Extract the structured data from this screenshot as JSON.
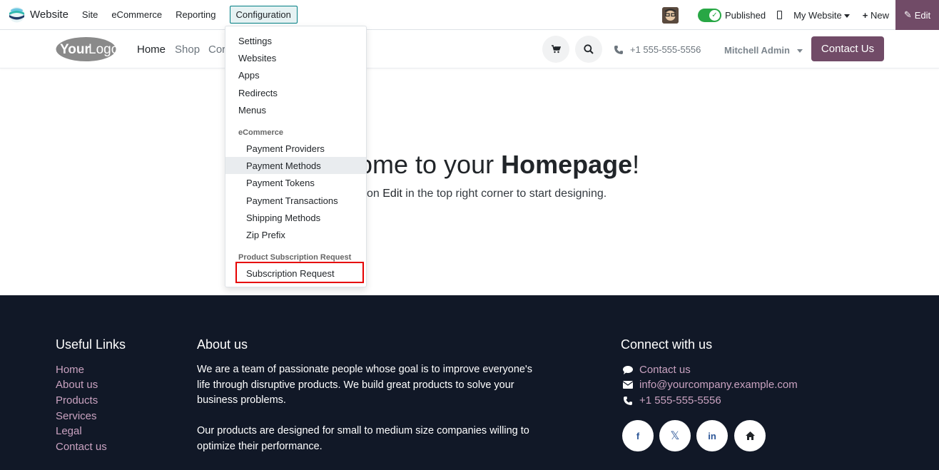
{
  "topbar": {
    "app_name": "Website",
    "menus": [
      "Site",
      "eCommerce",
      "Reporting"
    ],
    "active_menu": "Configuration",
    "published_label": "Published",
    "website_label": "My Website",
    "new_label": "New",
    "edit_label": "Edit"
  },
  "site_header": {
    "logo_text_1": "Your",
    "logo_text_2": "Logo",
    "nav": [
      "Home",
      "Shop",
      "Cor"
    ],
    "phone": "+1 555-555-5556",
    "user": "Mitchell Admin",
    "contact_btn": "Contact Us"
  },
  "dropdown": {
    "items": [
      "Settings",
      "Websites",
      "Apps",
      "Redirects",
      "Menus"
    ],
    "section_ecommerce": "eCommerce",
    "ecommerce_items": [
      "Payment Providers",
      "Payment Methods",
      "Payment Tokens",
      "Payment Transactions",
      "Shipping Methods",
      "Zip Prefix"
    ],
    "section_subscription": "Product Subscription Request",
    "subscription_item": "Subscription Request"
  },
  "hero": {
    "title_prefix": "ome to your ",
    "title_bold": "Homepage",
    "title_suffix": "!",
    "sub_prefix": "on ",
    "sub_bold": "Edit",
    "sub_suffix": " in the top right corner to start designing."
  },
  "footer": {
    "useful_links_title": "Useful Links",
    "useful_links": [
      "Home",
      "About us",
      "Products",
      "Services",
      "Legal",
      "Contact us"
    ],
    "about_title": "About us",
    "about_p1": "We are a team of passionate people whose goal is to improve everyone's life through disruptive products. We build great products to solve your business problems.",
    "about_p2": "Our products are designed for small to medium size companies willing to optimize their performance.",
    "connect_title": "Connect with us",
    "contact_us": "Contact us",
    "email": "info@yourcompany.example.com",
    "phone": "+1 555-555-5556",
    "social": [
      "facebook-icon",
      "x-icon",
      "linkedin-icon",
      "home-icon"
    ]
  },
  "colors": {
    "brand": "#714b67",
    "footer_bg": "#111827",
    "footer_link": "#c9a2c0",
    "highlight": "#e60000"
  }
}
